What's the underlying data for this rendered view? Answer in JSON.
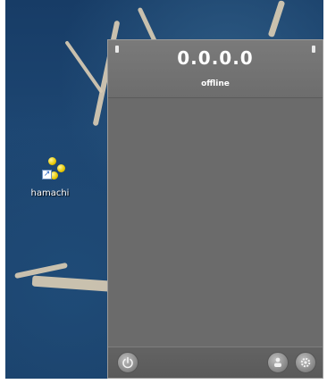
{
  "desktop": {
    "icon": {
      "label": "hamachi",
      "icon_name": "hamachi-icon",
      "overlay": "shortcut-arrow-icon"
    }
  },
  "hamachi": {
    "ip_address": "0.0.0.0",
    "status": "offline",
    "toolbar": {
      "power_icon": "power-icon",
      "network_icon": "network-icon",
      "settings_icon": "settings-icon"
    }
  },
  "colors": {
    "desktop_bg": "#1b426d",
    "window_bg": "#6a6a6a",
    "text": "#ffffff"
  }
}
